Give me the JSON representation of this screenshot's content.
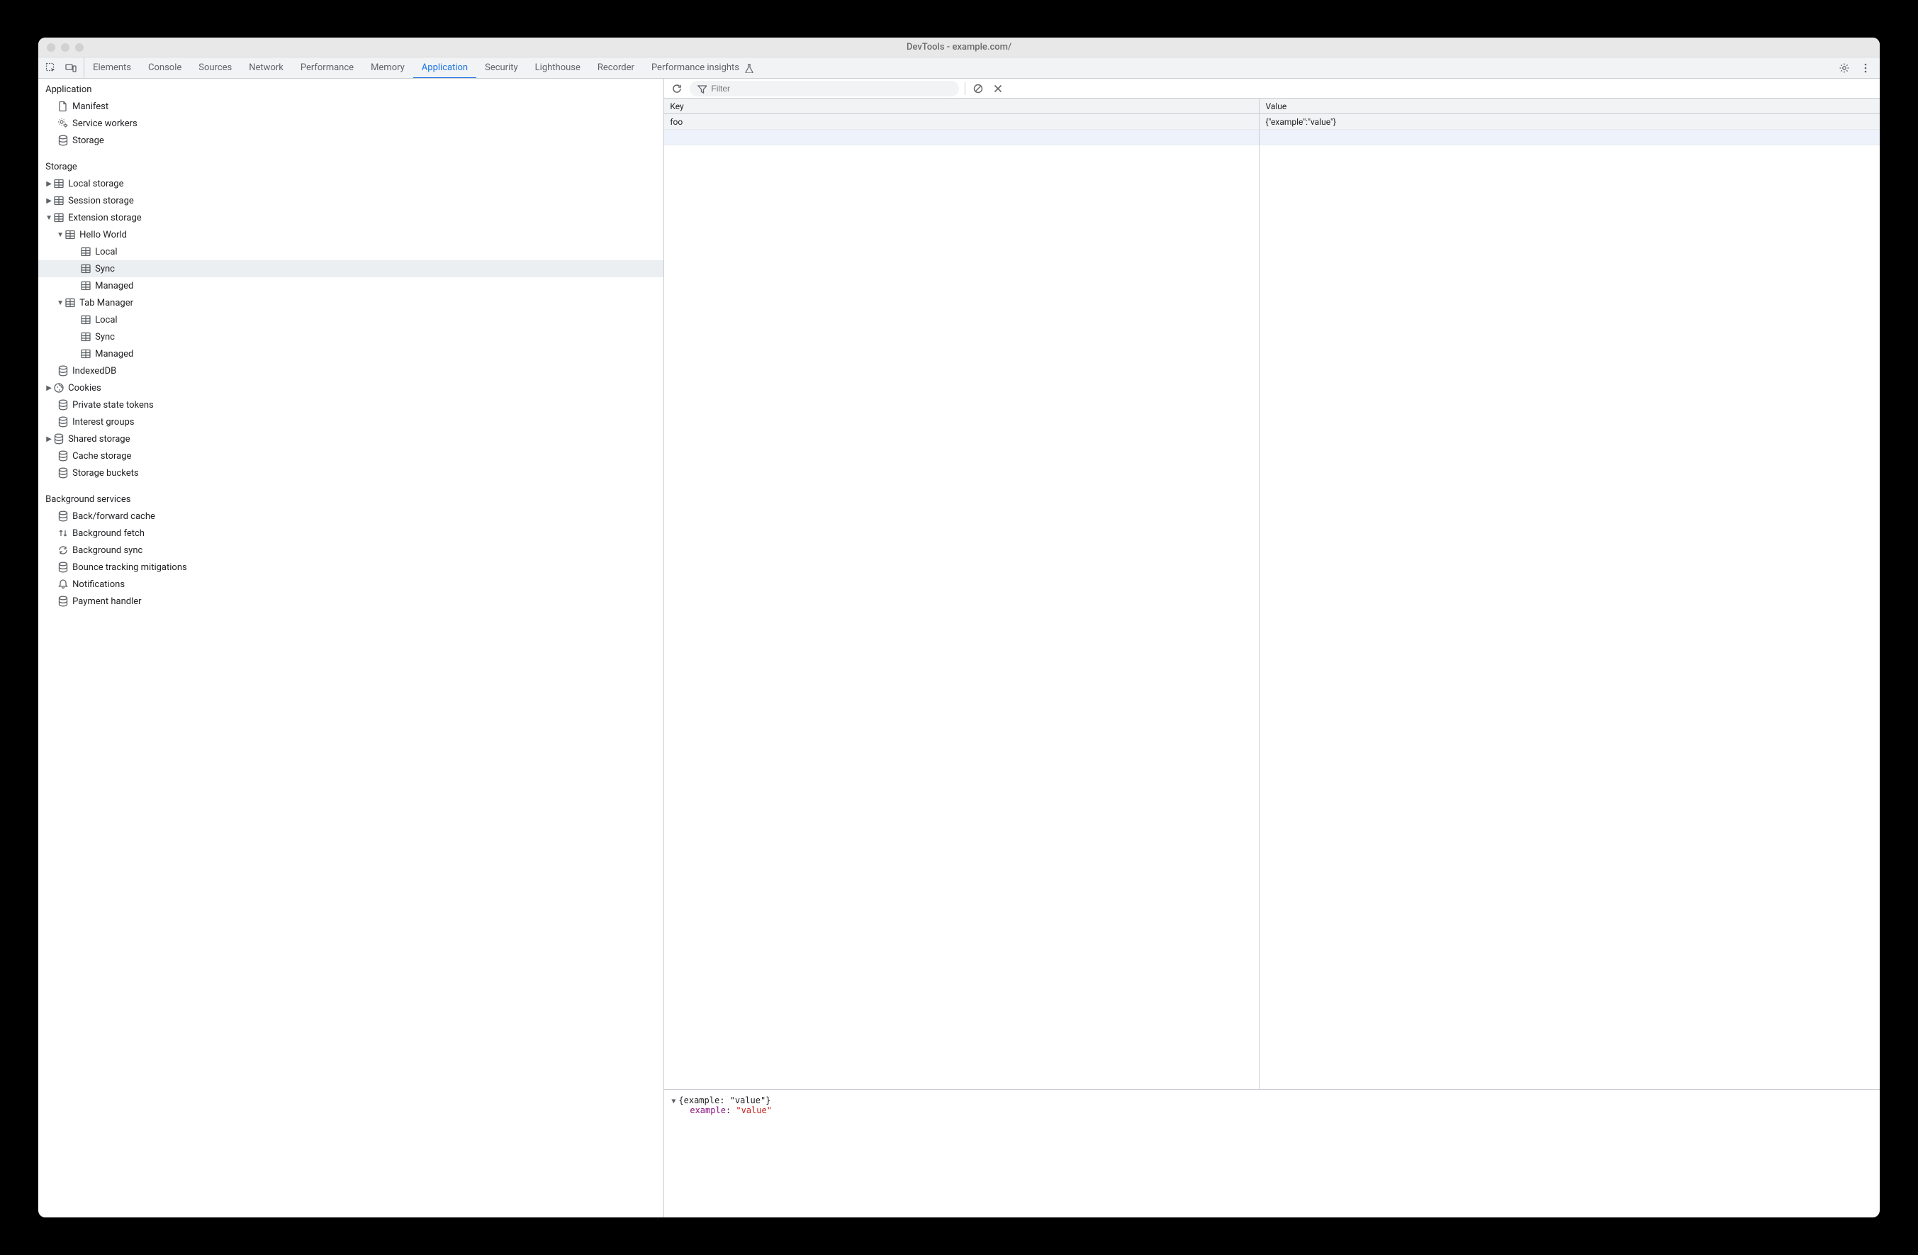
{
  "window": {
    "title": "DevTools - example.com/"
  },
  "tabs": [
    {
      "label": "Elements",
      "active": false
    },
    {
      "label": "Console",
      "active": false
    },
    {
      "label": "Sources",
      "active": false
    },
    {
      "label": "Network",
      "active": false
    },
    {
      "label": "Performance",
      "active": false
    },
    {
      "label": "Memory",
      "active": false
    },
    {
      "label": "Application",
      "active": true
    },
    {
      "label": "Security",
      "active": false
    },
    {
      "label": "Lighthouse",
      "active": false
    },
    {
      "label": "Recorder",
      "active": false
    },
    {
      "label": "Performance insights",
      "active": false,
      "flask": true
    }
  ],
  "sidebar": {
    "sections": {
      "application": {
        "title": "Application",
        "items": [
          {
            "label": "Manifest",
            "icon": "document"
          },
          {
            "label": "Service workers",
            "icon": "gears"
          },
          {
            "label": "Storage",
            "icon": "database"
          }
        ]
      },
      "storage": {
        "title": "Storage",
        "local_storage": "Local storage",
        "session_storage": "Session storage",
        "extension_storage": "Extension storage",
        "extensions": [
          {
            "name": "Hello World",
            "areas": [
              "Local",
              "Sync",
              "Managed"
            ]
          },
          {
            "name": "Tab Manager",
            "areas": [
              "Local",
              "Sync",
              "Managed"
            ]
          }
        ],
        "indexeddb": "IndexedDB",
        "cookies": "Cookies",
        "private_state_tokens": "Private state tokens",
        "interest_groups": "Interest groups",
        "shared_storage": "Shared storage",
        "cache_storage": "Cache storage",
        "storage_buckets": "Storage buckets"
      },
      "background": {
        "title": "Background services",
        "items": [
          {
            "label": "Back/forward cache",
            "icon": "database"
          },
          {
            "label": "Background fetch",
            "icon": "updown"
          },
          {
            "label": "Background sync",
            "icon": "sync"
          },
          {
            "label": "Bounce tracking mitigations",
            "icon": "database"
          },
          {
            "label": "Notifications",
            "icon": "bell"
          },
          {
            "label": "Payment handler",
            "icon": "database"
          }
        ]
      }
    }
  },
  "main": {
    "filter_placeholder": "Filter",
    "columns": {
      "key": "Key",
      "value": "Value"
    },
    "rows": [
      {
        "key": "foo",
        "value": "{\"example\":\"value\"}"
      }
    ],
    "preview": {
      "header": "{example: \"value\"}",
      "prop_key": "example",
      "prop_sep": ": ",
      "prop_val": "\"value\""
    }
  }
}
